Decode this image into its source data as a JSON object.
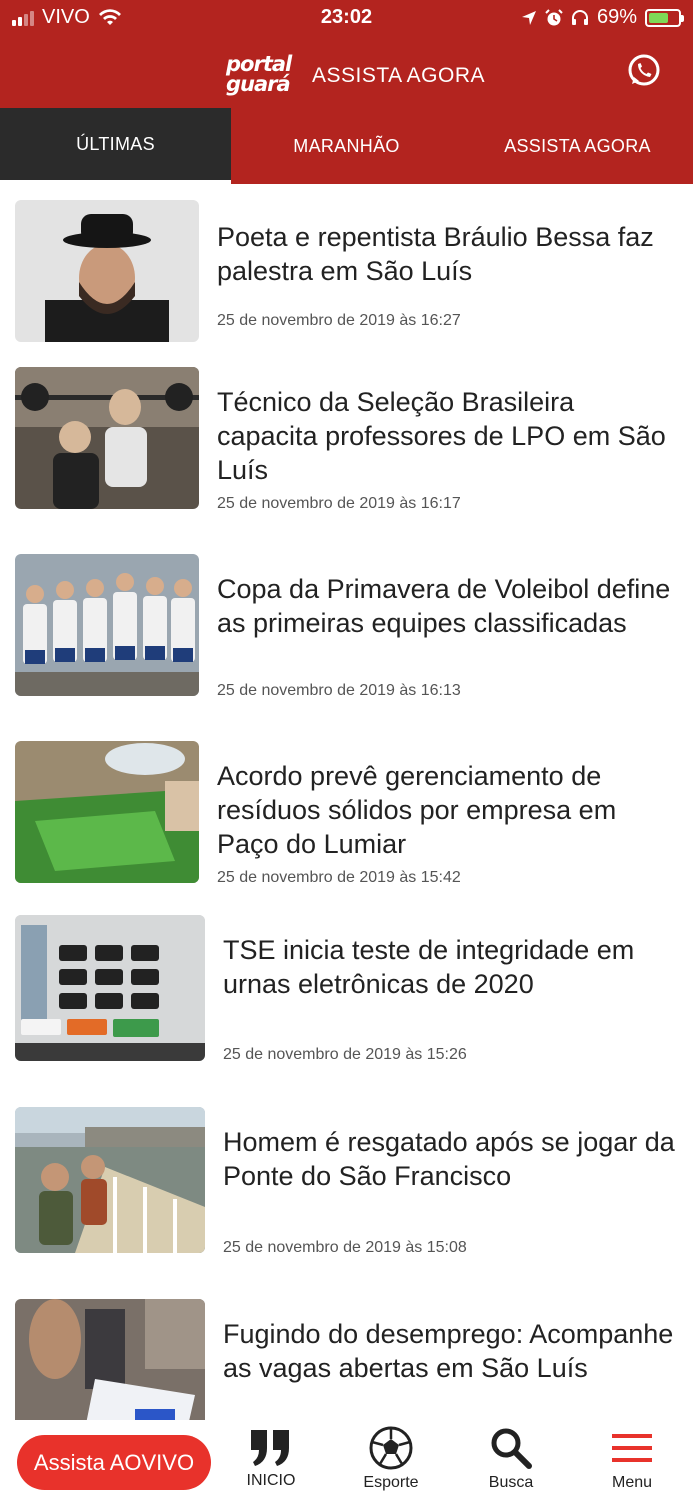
{
  "status_bar": {
    "carrier": "VIVO",
    "time": "23:02",
    "battery": "69%",
    "icons": [
      "signal-icon",
      "wifi-icon",
      "location-icon",
      "alarm-icon",
      "headphones-icon",
      "battery-charging-icon"
    ]
  },
  "header": {
    "logo_line1": "portal",
    "logo_line2": "guará",
    "title": "ASSISTA AGORA",
    "whatsapp_icon": "whatsapp-icon"
  },
  "tabs": [
    {
      "label": "ÚLTIMAS",
      "active": true
    },
    {
      "label": "MARANHÃO",
      "active": false
    },
    {
      "label": "ASSISTA AGORA",
      "active": false
    }
  ],
  "articles": [
    {
      "title": "Poeta e repentista Bráulio Bessa faz palestra em São Luís",
      "date": "25 de novembro de 2019 às 16:27"
    },
    {
      "title": "Técnico da Seleção Brasileira capacita professores de LPO em São Luís",
      "date": "25 de novembro de 2019 às 16:17"
    },
    {
      "title": "Copa da Primavera de Voleibol define as primeiras equipes classificadas",
      "date": "25 de novembro de 2019 às 16:13"
    },
    {
      "title": "Acordo prevê gerenciamento de resíduos sólidos por empresa em Paço do Lumiar",
      "date": "25 de novembro de 2019 às 15:42"
    },
    {
      "title": "TSE inicia teste de integridade em urnas eletrônicas de 2020",
      "date": "25 de novembro de 2019 às 15:26"
    },
    {
      "title": "Homem é resgatado após se jogar da Ponte do São Francisco",
      "date": "25 de novembro de 2019 às 15:08"
    },
    {
      "title": "Fugindo do desemprego: Acompanhe as vagas abertas em São Luís",
      "date": ""
    }
  ],
  "bottom_bar": {
    "live_button": "Assista AOVIVO",
    "items": [
      {
        "label": "INICIO",
        "icon": "quote-icon"
      },
      {
        "label": "Esporte",
        "icon": "soccer-ball-icon"
      },
      {
        "label": "Busca",
        "icon": "search-icon"
      },
      {
        "label": "Menu",
        "icon": "hamburger-menu-icon"
      }
    ]
  },
  "colors": {
    "brand_red": "#b3241f",
    "active_tab": "#2b2b2b",
    "live_button": "#e8322b",
    "menu_icon": "#e8322b"
  }
}
